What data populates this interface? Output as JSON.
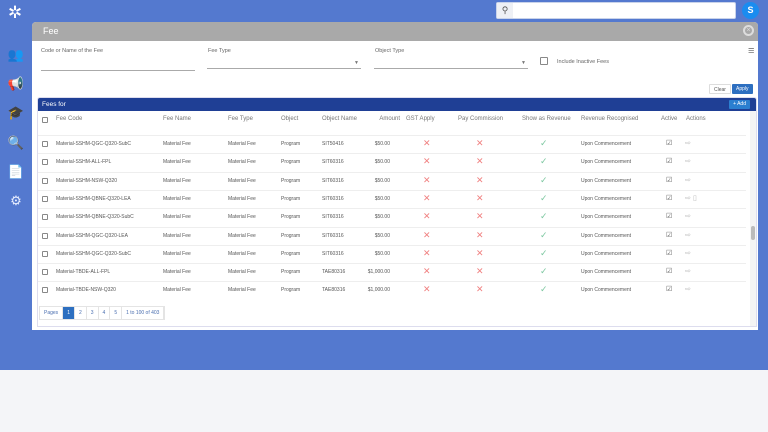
{
  "top": {
    "search_placeholder": "",
    "avatar": "S"
  },
  "sidebar": {
    "icons": [
      "people-icon",
      "megaphone-icon",
      "certificate-icon",
      "document-search-icon",
      "report-icon",
      "gear-icon"
    ]
  },
  "panel": {
    "title": "Fee"
  },
  "filters": {
    "code_label": "Code or Name of the Fee",
    "code_value": "",
    "fee_type_label": "Fee Type",
    "fee_type_value": "",
    "object_type_label": "Object Type",
    "object_type_value": "",
    "include_inactive": "Include Inactive Fees",
    "include_inactive_checked": false,
    "clear": "Clear",
    "apply": "Apply"
  },
  "table": {
    "title": "Fees for",
    "add": "+ Add",
    "columns": [
      "Fee Code",
      "Fee Name",
      "Fee Type",
      "Object",
      "Object Name",
      "Amount",
      "GST Apply",
      "Pay Commission",
      "Show as Revenue",
      "Revenue Recognised",
      "Active",
      "Actions"
    ],
    "rows": [
      [
        "Material-SSHM-QGC-Q320-SubC",
        "Material Fee",
        "Material Fee",
        "Program",
        "SIT50416",
        "$50.00",
        "Upon Commencement"
      ],
      [
        "Material-SSHM-ALL-FPL",
        "Material Fee",
        "Material Fee",
        "Program",
        "SIT60316",
        "$50.00",
        "Upon Commencement"
      ],
      [
        "Material-SSHM-NSW-Q320",
        "Material Fee",
        "Material Fee",
        "Program",
        "SIT60316",
        "$50.00",
        "Upon Commencement"
      ],
      [
        "Material-SSHM-QBNE-Q320-LEA",
        "Material Fee",
        "Material Fee",
        "Program",
        "SIT60316",
        "$50.00",
        "Upon Commencement"
      ],
      [
        "Material-SSHM-QBNE-Q320-SubC",
        "Material Fee",
        "Material Fee",
        "Program",
        "SIT60316",
        "$50.00",
        "Upon Commencement"
      ],
      [
        "Material-SSHM-QGC-Q320-LEA",
        "Material Fee",
        "Material Fee",
        "Program",
        "SIT60316",
        "$50.00",
        "Upon Commencement"
      ],
      [
        "Material-SSHM-QGC-Q320-SubC",
        "Material Fee",
        "Material Fee",
        "Program",
        "SIT60316",
        "$50.00",
        "Upon Commencement"
      ],
      [
        "Material-TBDE-ALL-FPL",
        "Material Fee",
        "Material Fee",
        "Program",
        "TAE80316",
        "$1,000.00",
        "Upon Commencement"
      ],
      [
        "Material-TBDE-NSW-Q320",
        "Material Fee",
        "Material Fee",
        "Program",
        "TAE80316",
        "$1,000.00",
        "Upon Commencement"
      ]
    ]
  },
  "pagination": {
    "label": "Pages",
    "pages": [
      "1",
      "2",
      "3",
      "4",
      "5"
    ],
    "current": "1",
    "summary": "1 to 100 of 403"
  },
  "colors": {
    "brand": "#5479cf",
    "table_header": "#1f3f95",
    "accent": "#2d6fc0"
  }
}
